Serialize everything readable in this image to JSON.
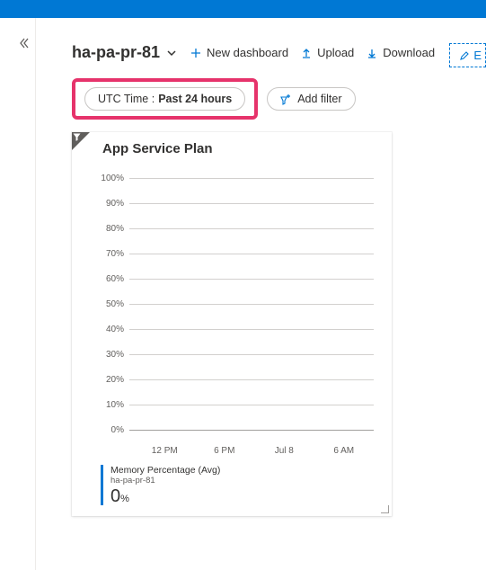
{
  "header": {
    "dashboard_name": "ha-pa-pr-81",
    "new_dashboard": "New dashboard",
    "upload": "Upload",
    "download": "Download",
    "edit_partial": "E"
  },
  "filters": {
    "time_label": "UTC Time :",
    "time_value": "Past 24 hours",
    "add_filter": "Add filter"
  },
  "card": {
    "title": "App Service Plan"
  },
  "chart_data": {
    "type": "line",
    "title": "App Service Plan",
    "ylabel": "",
    "xlabel": "",
    "ylim": [
      0,
      100
    ],
    "y_ticks": [
      "100%",
      "90%",
      "80%",
      "70%",
      "60%",
      "50%",
      "40%",
      "30%",
      "20%",
      "10%",
      "0%"
    ],
    "x_ticks": [
      "12 PM",
      "6 PM",
      "Jul 8",
      "6 AM"
    ],
    "series": [
      {
        "name": "Memory Percentage (Avg)",
        "resource": "ha-pa-pr-81",
        "values": [
          0,
          0,
          0,
          0
        ],
        "summary_value": "0",
        "summary_unit": "%",
        "color": "#0078d4"
      }
    ]
  }
}
